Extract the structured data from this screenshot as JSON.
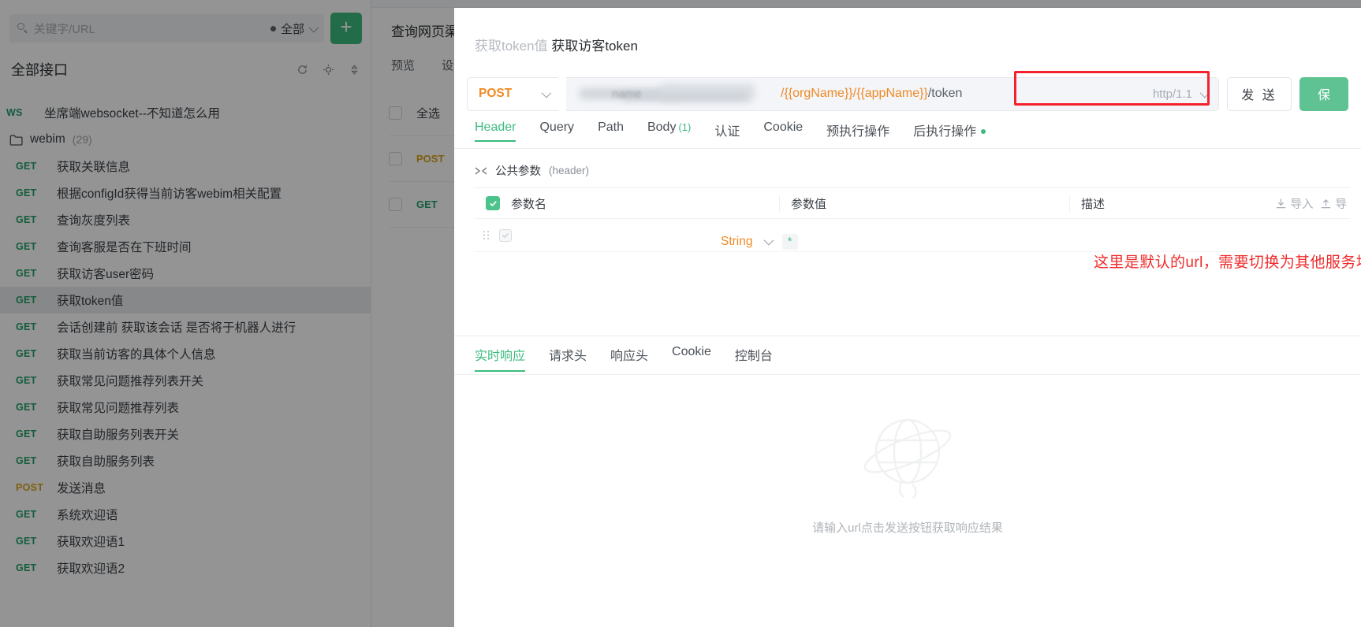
{
  "background": {
    "search": {
      "placeholder": "关键字/URL",
      "filter_label": "全部",
      "add_label": "+"
    },
    "all_api_title": "全部接口",
    "list": [
      {
        "verb": "WS",
        "label": "坐席端websocket--不知道怎么用",
        "type": "ws"
      },
      {
        "verb": "",
        "label": "webim",
        "type": "folder",
        "count": "(29)"
      },
      {
        "verb": "GET",
        "label": "获取关联信息",
        "type": "get"
      },
      {
        "verb": "GET",
        "label": "根据configId获得当前访客webim相关配置",
        "type": "get"
      },
      {
        "verb": "GET",
        "label": "查询灰度列表",
        "type": "get"
      },
      {
        "verb": "GET",
        "label": "查询客服是否在下班时间",
        "type": "get"
      },
      {
        "verb": "GET",
        "label": "获取访客user密码",
        "type": "get"
      },
      {
        "verb": "GET",
        "label": "获取token值",
        "type": "get",
        "selected": true
      },
      {
        "verb": "GET",
        "label": "会话创建前 获取该会话  是否将于机器人进行",
        "type": "get"
      },
      {
        "verb": "GET",
        "label": "获取当前访客的具体个人信息",
        "type": "get"
      },
      {
        "verb": "GET",
        "label": "获取常见问题推荐列表开关",
        "type": "get"
      },
      {
        "verb": "GET",
        "label": "获取常见问题推荐列表",
        "type": "get"
      },
      {
        "verb": "GET",
        "label": "获取自助服务列表开关",
        "type": "get"
      },
      {
        "verb": "GET",
        "label": "获取自助服务列表",
        "type": "get"
      },
      {
        "verb": "POST",
        "label": "发送消息",
        "type": "post"
      },
      {
        "verb": "GET",
        "label": "系统欢迎语",
        "type": "get"
      },
      {
        "verb": "GET",
        "label": "获取欢迎语1",
        "type": "get"
      },
      {
        "verb": "GET",
        "label": "获取欢迎语2",
        "type": "get"
      }
    ],
    "mid_pane": {
      "title": "查询网页渠道",
      "tabs": [
        "预览",
        "设"
      ],
      "select_all": "全选",
      "rows": [
        {
          "verb": "POST"
        },
        {
          "verb": "GET"
        }
      ]
    }
  },
  "panel": {
    "title_muted": "获取token值",
    "title_strong": "获取访客token",
    "urlbar": {
      "method": "POST",
      "url_redacted_hint": "name",
      "url_tail_org": "/{{orgName}}",
      "url_tail_app": "/{{appName}}",
      "url_tail_path": "/token",
      "protocol": "http/1.1",
      "send_label": "发 送",
      "save_label": "保"
    },
    "request_tabs": [
      {
        "label": "Header",
        "active": true
      },
      {
        "label": "Query",
        "active": false
      },
      {
        "label": "Path",
        "active": false
      },
      {
        "label": "Body",
        "active": false,
        "count": "(1)"
      },
      {
        "label": "认证",
        "active": false
      },
      {
        "label": "Cookie",
        "active": false
      },
      {
        "label": "预执行操作",
        "active": false
      },
      {
        "label": "后执行操作",
        "active": false,
        "dot": true
      }
    ],
    "public_params": {
      "label": "公共参数",
      "sub": "(header)"
    },
    "param_table": {
      "headers": {
        "name": "参数名",
        "value": "参数值",
        "desc": "描述"
      },
      "actions": {
        "import": "导入",
        "export": "导"
      },
      "rows": [
        {
          "type": "String",
          "required": "*"
        }
      ]
    },
    "annotation": "这里是默认的url，需要切换为其他服务地址",
    "response_tabs": [
      {
        "label": "实时响应",
        "active": true
      },
      {
        "label": "请求头",
        "active": false
      },
      {
        "label": "响应头",
        "active": false
      },
      {
        "label": "Cookie",
        "active": false
      },
      {
        "label": "控制台",
        "active": false
      }
    ],
    "empty_state": "请输入url点击发送按钮获取响应结果"
  },
  "colors": {
    "accent_green": "#3bbb7e",
    "method_orange": "#f08a24",
    "annotation_red": "#ef2b2b",
    "highlight_red": "#f5222d"
  }
}
